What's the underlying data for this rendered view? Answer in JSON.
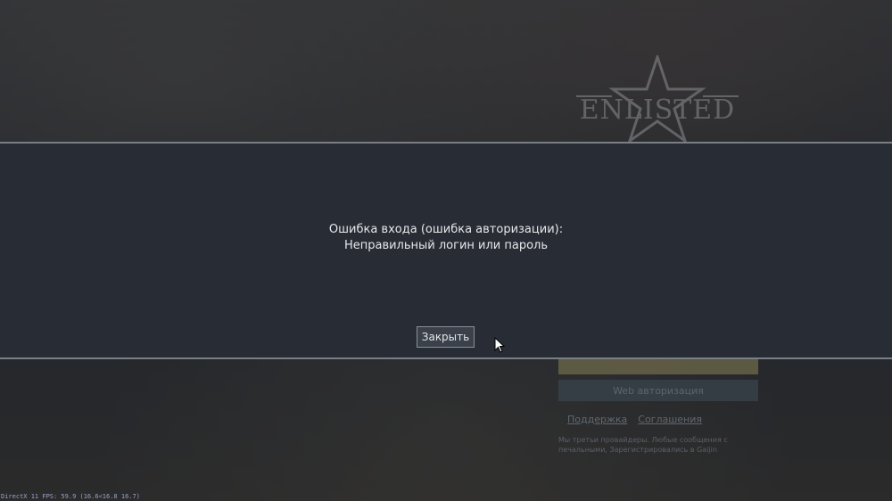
{
  "background": {
    "logo_text": "ENLISTED",
    "web_auth_label": "Web авторизация",
    "links": [
      "Поддержка",
      "Соглашения"
    ],
    "notice": "Мы третьи провайдеры. Любые сообщения с печальными, Зарегистрировались в Gaijin"
  },
  "dialog": {
    "message_line1": "Ошибка входа (ошибка авторизации):",
    "message_line2": "Неправильный логин или пароль",
    "close_label": "Закрыть"
  },
  "overlay": {
    "fps_text": "DirectX 11 FPS: 59.9 (16.6<16.8 16.7)"
  },
  "colors": {
    "modal_bg": "#282c34",
    "modal_border": "#7a7f86",
    "button_bg": "#3b414a",
    "text": "#e6e8eb"
  },
  "icons": [
    "logo-star-icon",
    "mouse-cursor-icon"
  ]
}
